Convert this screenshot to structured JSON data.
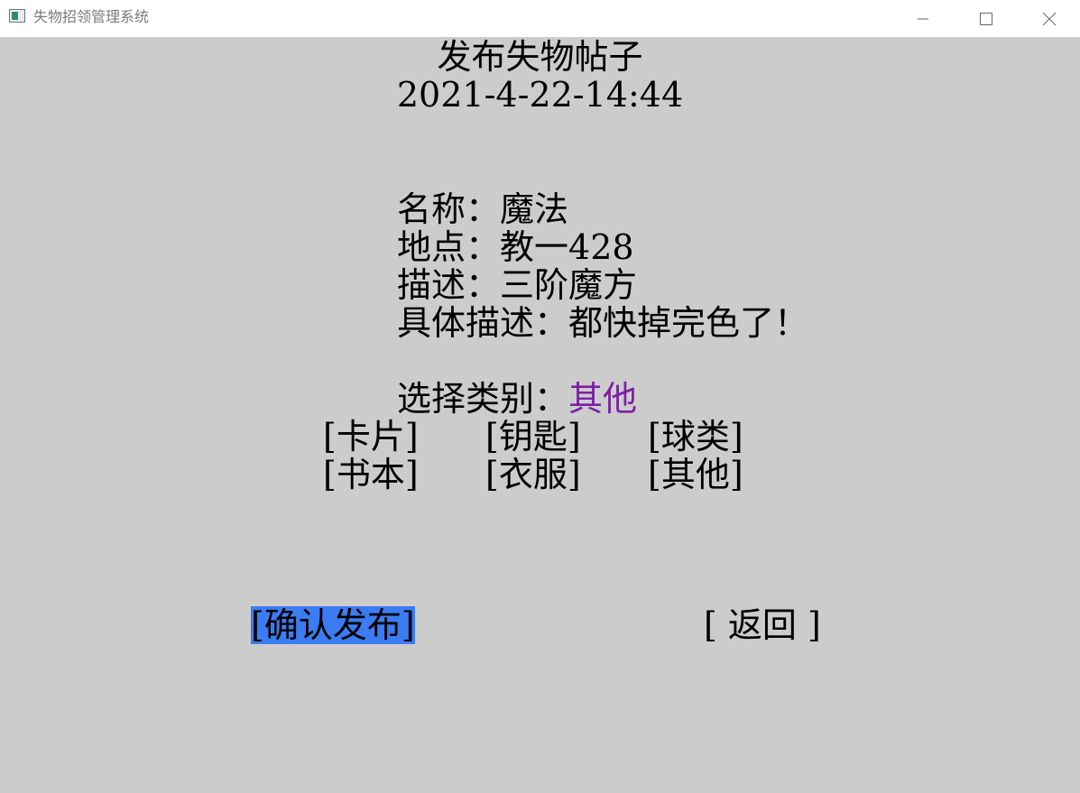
{
  "window": {
    "title": "失物招领管理系统",
    "app_icon": "console-window-icon",
    "controls": [
      "minimize-icon",
      "maximize-icon",
      "close-icon"
    ]
  },
  "page": {
    "heading": "发布失物帖子",
    "timestamp": "2021-4-22-14:44"
  },
  "fields": {
    "name_label": "名称：",
    "name_value": "魔法",
    "location_label": "地点：",
    "location_value": "教一428",
    "desc_label": "描述：",
    "desc_value": "三阶魔方",
    "detail_label": "具体描述：",
    "detail_value": "都快掉完色了！"
  },
  "category": {
    "label": "选择类别：",
    "selected": "其他",
    "selected_color": "#7b1fa2",
    "options": [
      "[卡片]",
      "[钥匙]",
      "[球类]",
      "[书本]",
      "[衣服]",
      "[其他]"
    ]
  },
  "actions": {
    "confirm_label": "[确认发布]",
    "confirm_highlight": "#3c7cf2",
    "back_label": "[ 返回 ]"
  }
}
